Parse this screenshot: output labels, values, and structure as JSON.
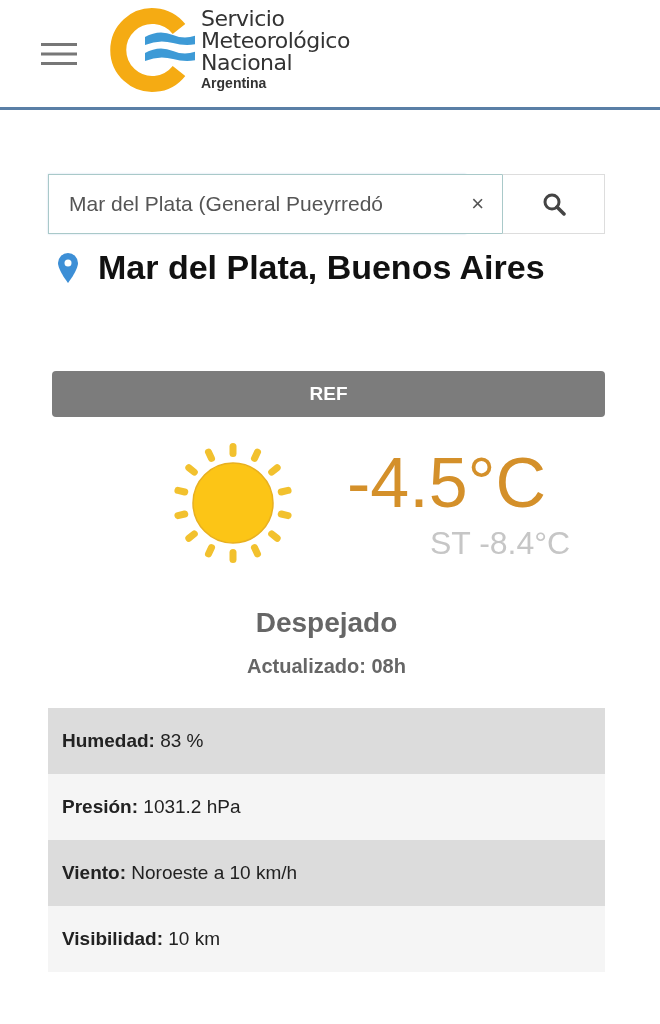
{
  "header": {
    "logo": {
      "lines": [
        "Servicio",
        "Meteorológico",
        "Nacional"
      ],
      "country": "Argentina"
    }
  },
  "search": {
    "value": "Mar del Plata (General Pueyrredó",
    "clear": "×"
  },
  "location": "Mar del Plata, Buenos Aires",
  "station_bar": "REF",
  "current": {
    "temperature": "-4.5°C",
    "feels_like": "ST -8.4°C",
    "condition": "Despejado",
    "updated": "Actualizado: 08h"
  },
  "details": [
    {
      "text": "**Humedad:** 83 %"
    },
    {
      "text": "**Presión:** 1031.2 hPa"
    },
    {
      "text": "**Viento:** Noroeste a 10 km/h"
    },
    {
      "text": "**Visibilidad:** 10 km"
    }
  ]
}
